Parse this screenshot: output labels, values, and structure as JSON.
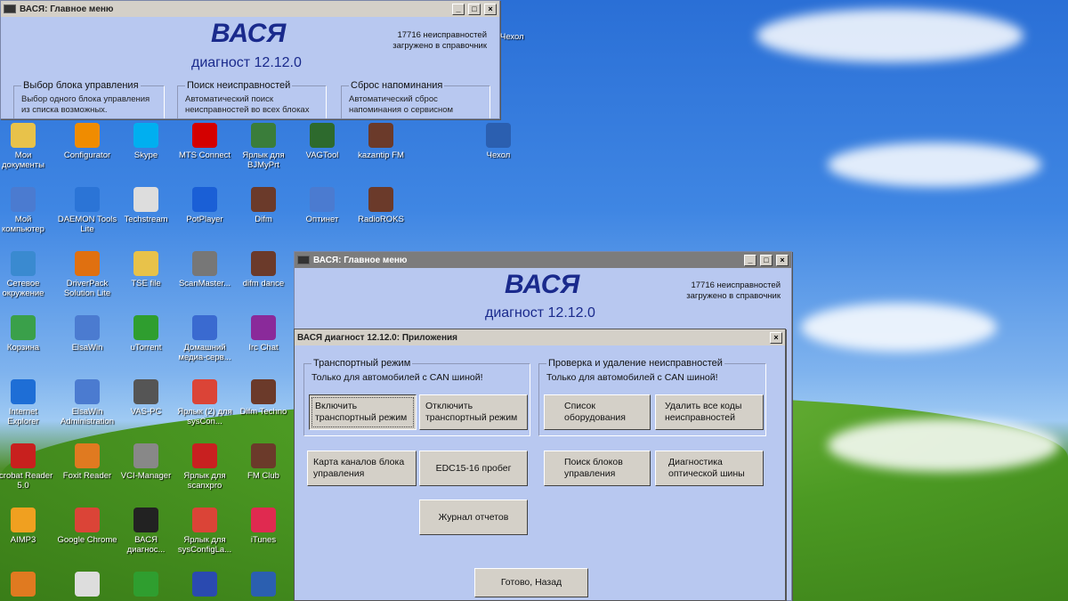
{
  "desktop_icons": [
    {
      "label": "Мои документы",
      "icon": "folder-documents-icon",
      "color": "#e8c24a"
    },
    {
      "label": "Configurator",
      "icon": "vc-icon",
      "color": "#f08c00"
    },
    {
      "label": "Skype",
      "icon": "skype-icon",
      "color": "#00aff0"
    },
    {
      "label": "MTS Connect",
      "icon": "mts-icon",
      "color": "#d40000"
    },
    {
      "label": "Ярлык для BJMyPrt",
      "icon": "user-icon",
      "color": "#3a7d3a"
    },
    {
      "label": "VAGTool",
      "icon": "monitor-icon",
      "color": "#2d6a2d"
    },
    {
      "label": "kazantip FM",
      "icon": "ram-icon",
      "color": "#6b3a2a"
    },
    {
      "label": "Мой компьютер",
      "icon": "computer-icon",
      "color": "#4b7bd0"
    },
    {
      "label": "DAEMON Tools Lite",
      "icon": "daemon-icon",
      "color": "#2b74d6"
    },
    {
      "label": "Techstream",
      "icon": "techstream-icon",
      "color": "#dddddd"
    },
    {
      "label": "PotPlayer",
      "icon": "potplayer-icon",
      "color": "#1a5fd6"
    },
    {
      "label": "Difm",
      "icon": "ram-icon",
      "color": "#6b3a2a"
    },
    {
      "label": "Оптинет",
      "icon": "network-icon",
      "color": "#4b7bd0"
    },
    {
      "label": "RadioROKS",
      "icon": "ram-icon",
      "color": "#6b3a2a"
    },
    {
      "label": "Сетевое окружение",
      "icon": "globe-icon",
      "color": "#3a8ad0"
    },
    {
      "label": "DriverPack Solution Lite",
      "icon": "driverpack-icon",
      "color": "#e07010"
    },
    {
      "label": "TSE file",
      "icon": "folder-icon",
      "color": "#e8c24a"
    },
    {
      "label": "ScanMaster...",
      "icon": "chip-icon",
      "color": "#777777"
    },
    {
      "label": "difm dance",
      "icon": "ram-icon",
      "color": "#6b3a2a"
    },
    {
      "label": "Корзина",
      "icon": "recycle-bin-icon",
      "color": "#3aa04a"
    },
    {
      "label": "ElsaWin",
      "icon": "elsawin-icon",
      "color": "#4b7bd0"
    },
    {
      "label": "uTorrent",
      "icon": "utorrent-icon",
      "color": "#2f9e2f"
    },
    {
      "label": "Домашний медиа-серв...",
      "icon": "media-server-icon",
      "color": "#3a6ad0"
    },
    {
      "label": "Irc Chat",
      "icon": "irc-icon",
      "color": "#8a2a9a"
    },
    {
      "label": "Internet Explorer",
      "icon": "ie-icon",
      "color": "#1e6ed6"
    },
    {
      "label": "ElsaWin Administration",
      "icon": "elsawin-admin-icon",
      "color": "#4b7bd0"
    },
    {
      "label": "VAS-PC",
      "icon": "vas-icon",
      "color": "#555555"
    },
    {
      "label": "Ярлык (2) для sysCon...",
      "icon": "chrome-icon",
      "color": "#db4437"
    },
    {
      "label": "Difm Techno",
      "icon": "ram-icon",
      "color": "#6b3a2a"
    },
    {
      "label": "Acrobat Reader 5.0",
      "icon": "acrobat-icon",
      "color": "#c8201e"
    },
    {
      "label": "Foxit Reader",
      "icon": "foxit-icon",
      "color": "#e07a20"
    },
    {
      "label": "VCI-Manager",
      "icon": "vci-icon",
      "color": "#888888"
    },
    {
      "label": "Ярлык для scanxpro",
      "icon": "car-icon",
      "color": "#c82020"
    },
    {
      "label": "FM Club",
      "icon": "ram-icon",
      "color": "#6b3a2a"
    },
    {
      "label": "AIMP3",
      "icon": "aimp-icon",
      "color": "#f0a020"
    },
    {
      "label": "Google Chrome",
      "icon": "chrome-icon",
      "color": "#db4437"
    },
    {
      "label": "ВАСЯ диагнос...",
      "icon": "vasya-icon",
      "color": "#222222"
    },
    {
      "label": "Ярлык для sysConfigLa...",
      "icon": "chrome-icon",
      "color": "#db4437"
    },
    {
      "label": "iTunes",
      "icon": "itunes-icon",
      "color": "#e02a50"
    },
    {
      "label": "Чехол",
      "icon": "word-doc-icon",
      "color": "#2b5fb0"
    },
    {
      "label": "",
      "icon": "app-icon",
      "color": "#e07a20"
    },
    {
      "label": "",
      "icon": "shortcut-icon",
      "color": "#dddddd"
    },
    {
      "label": "",
      "icon": "utorrent-icon",
      "color": "#2f9e2f"
    },
    {
      "label": "",
      "icon": "floppy-icon",
      "color": "#2a4ab0"
    },
    {
      "label": "",
      "icon": "word-doc-icon",
      "color": "#2b5fb0"
    }
  ],
  "back_window": {
    "title": "ВАСЯ: Главное меню",
    "app_name": "ВАСЯ",
    "version": "диагност 12.12.0",
    "faults_line1": "17716 неисправностей",
    "faults_line2": "загружено в справочник",
    "groups": [
      {
        "legend": "Выбор блока управления",
        "desc": "Выбор одного блока управления из списка возможных."
      },
      {
        "legend": "Поиск неисправностей",
        "desc": "Автоматический поиск неисправностей во всех блоках"
      },
      {
        "legend": "Сброс напоминания",
        "desc": "Автоматический сброс напоминания о сервисном"
      }
    ],
    "behind_icon_text": "Чехол"
  },
  "main_window": {
    "title": "ВАСЯ: Главное меню",
    "app_name": "ВАСЯ",
    "version": "диагност 12.12.0",
    "faults_line1": "17716 неисправностей",
    "faults_line2": "загружено в справочник"
  },
  "dialog": {
    "title": "ВАСЯ диагност 12.12.0: Приложения",
    "group_transport": {
      "legend": "Транспортный режим",
      "note": "Только для автомобилей с CAN шиной!",
      "btn_on": "Включить транспортный режим",
      "btn_off": "Отключить транспортный режим"
    },
    "group_faults": {
      "legend": "Проверка и удаление неисправностей",
      "note": "Только для автомобилей с CAN шиной!",
      "btn_list": "Список оборудования",
      "btn_delete": "Удалить все коды неисправностей"
    },
    "btn_channel_map": "Карта каналов блока управления",
    "btn_edc": "EDC15-16 пробег",
    "btn_search_blocks": "Поиск блоков управления",
    "btn_optical": "Диагностика оптической шины",
    "btn_log": "Журнал отчетов",
    "btn_done": "Готово, Назад"
  }
}
